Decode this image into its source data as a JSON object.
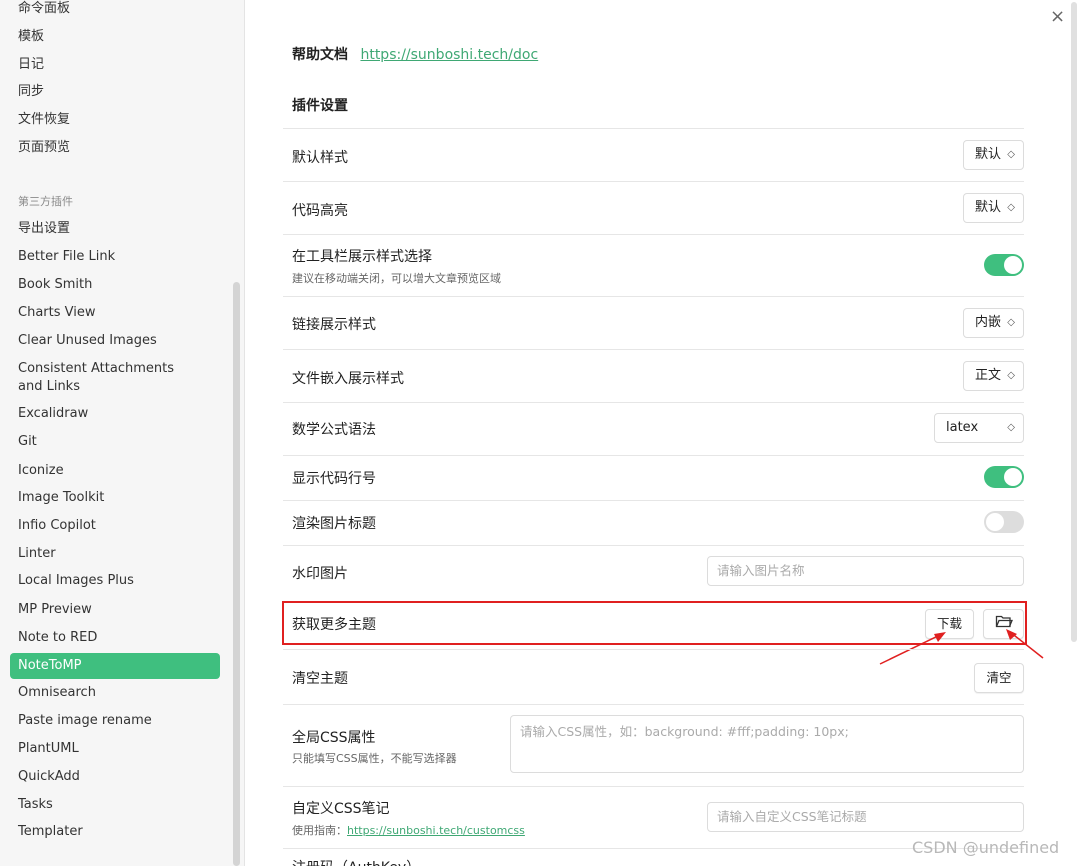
{
  "sidebar": {
    "core_items": [
      "命令面板",
      "模板",
      "日记",
      "同步",
      "文件恢复",
      "页面预览"
    ],
    "section_label": "第三方插件",
    "plugin_items": [
      "导出设置",
      "Better File Link",
      "Book Smith",
      "Charts View",
      "Clear Unused Images",
      "Consistent Attachments and Links",
      "Excalidraw",
      "Git",
      "Iconize",
      "Image Toolkit",
      "Infio Copilot",
      "Linter",
      "Local Images Plus",
      "MP Preview",
      "Note to RED",
      "NoteToMP",
      "Omnisearch",
      "Paste image rename",
      "PlantUML",
      "QuickAdd",
      "Tasks",
      "Templater"
    ],
    "active_item": "NoteToMP"
  },
  "main": {
    "close_icon": "×",
    "help": {
      "label": "帮助文档",
      "link": "https://sunboshi.tech/doc"
    },
    "section_title": "插件设置",
    "rows": {
      "default_style": {
        "label": "默认样式",
        "value": "默认"
      },
      "code_highlight": {
        "label": "代码高亮",
        "value": "默认"
      },
      "toolbar_style": {
        "label": "在工具栏展示样式选择",
        "desc": "建议在移动端关闭，可以增大文章预览区域",
        "state": "on"
      },
      "link_style": {
        "label": "链接展示样式",
        "value": "内嵌"
      },
      "embed_style": {
        "label": "文件嵌入展示样式",
        "value": "正文"
      },
      "math_syntax": {
        "label": "数学公式语法",
        "value": "latex"
      },
      "line_numbers": {
        "label": "显示代码行号",
        "state": "on"
      },
      "image_caption": {
        "label": "渲染图片标题",
        "state": "off"
      },
      "watermark": {
        "label": "水印图片",
        "placeholder": "请输入图片名称"
      },
      "more_themes": {
        "label": "获取更多主题",
        "download_label": "下载"
      },
      "clear_theme": {
        "label": "清空主题",
        "button_label": "清空"
      },
      "global_css": {
        "label": "全局CSS属性",
        "desc": "只能填写CSS属性，不能写选择器",
        "placeholder": "请输入CSS属性，如：background: #fff;padding: 10px;"
      },
      "custom_css": {
        "label": "自定义CSS笔记",
        "desc_prefix": "使用指南：",
        "desc_link": "https://sunboshi.tech/customcss",
        "placeholder": "请输入自定义CSS笔记标题"
      },
      "partial_next": {
        "label": "注册码（AuthKey）"
      }
    }
  },
  "watermark": "CSDN @undefined",
  "colors": {
    "accent": "#3fbf7f",
    "link": "#3fa874",
    "highlight": "#e02020"
  }
}
